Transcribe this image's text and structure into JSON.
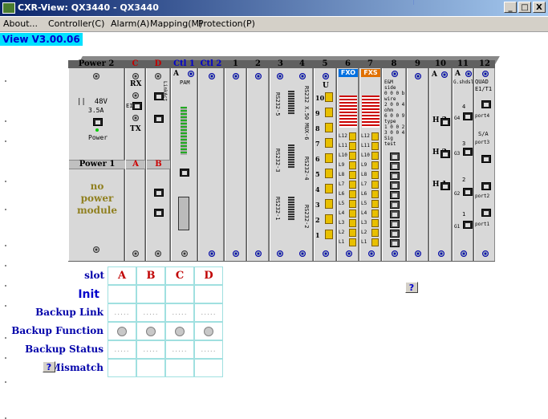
{
  "window": {
    "title": "CXR-View: QX3440 - QX3440",
    "minimize": "_",
    "maximize": "□",
    "close": "X"
  },
  "menu": [
    {
      "label": "About..."
    },
    {
      "label": "Controller(C)"
    },
    {
      "label": "Alarm(A)"
    },
    {
      "label": "Mapping(M)"
    },
    {
      "label": "Protection(P)"
    }
  ],
  "version": "View V3.00.06",
  "chassis": {
    "slot_headers": [
      {
        "label": "Power 2",
        "color": "black"
      },
      {
        "label": "C",
        "color": "red"
      },
      {
        "label": "D",
        "color": "red"
      },
      {
        "label": "Ctl 1",
        "color": "blue"
      },
      {
        "label": "Ctl 2",
        "color": "blue"
      },
      {
        "label": "1",
        "color": "black"
      },
      {
        "label": "2",
        "color": "black"
      },
      {
        "label": "3",
        "color": "black"
      },
      {
        "label": "4",
        "color": "black"
      },
      {
        "label": "5",
        "color": "black"
      },
      {
        "label": "6",
        "color": "black"
      },
      {
        "label": "7",
        "color": "black"
      },
      {
        "label": "8",
        "color": "black"
      },
      {
        "label": "9",
        "color": "black"
      },
      {
        "label": "10",
        "color": "black"
      },
      {
        "label": "11",
        "color": "black"
      },
      {
        "label": "12",
        "color": "black"
      }
    ],
    "power1_label": "Power 1",
    "power1_a": "A",
    "power1_b": "B",
    "power_module_msg": [
      "no",
      "power",
      "module"
    ],
    "power2": {
      "voltage": "48V",
      "current": "3.5A",
      "power": "Power"
    },
    "slot_c": {
      "rx": "RX",
      "tx": "TX",
      "ei": "EI",
      "e1": "E1"
    },
    "slot_d": {
      "link": "LinkAct",
      "txt": "10M/100M Col"
    },
    "ctl1": {
      "a": "A",
      "pam": "PAM"
    },
    "slot34": {
      "rs1": "RS232-5",
      "rs2": "RS232-3",
      "rs3": "RS232-1",
      "rs4": "RS232 X.50 MUX-6",
      "rs5": "RS232-4",
      "rs6": "RS232-2"
    },
    "slot5": {
      "u": "U",
      "nums": [
        "10",
        "9",
        "8",
        "7",
        "6",
        "5",
        "4",
        "3",
        "2",
        "1"
      ]
    },
    "slot6": {
      "head": "FXO",
      "ports": [
        "L12",
        "L11",
        "L10",
        "L9",
        "L8",
        "L7",
        "L6",
        "L5",
        "L4",
        "L3",
        "L2",
        "L1"
      ]
    },
    "slot7": {
      "head": "FXS"
    },
    "slot8": {
      "lines": [
        "E&M",
        "side",
        "0 0 0 b",
        "wire",
        "2 0 0 4",
        "ohm",
        "6 0 0 9",
        "type",
        "1 0 0 2",
        "3 0 0 4",
        "Sig",
        "test"
      ]
    },
    "slot10": {
      "a": "A",
      "h3": "H 3",
      "h2": "H 2",
      "h1": "H 1"
    },
    "slot11": {
      "a": "A",
      "shdsl": "G.shdsl",
      "g4": "G4",
      "g3": "G3",
      "g2": "G2",
      "g1": "G1",
      "n4": "4",
      "n3": "3",
      "n2": "2",
      "n1": "1"
    },
    "slot12": {
      "quad": "QUAD",
      "e1t1": "E1/T1",
      "port4": "port4",
      "sa": "S/A",
      "port3": "port3",
      "port2": "port2",
      "port1": "port1"
    }
  },
  "protection": {
    "header_label": "slot",
    "columns": [
      "A",
      "B",
      "C",
      "D"
    ],
    "rows": [
      {
        "label": "Init",
        "kind": "empty"
      },
      {
        "label": "Backup Link",
        "kind": "dots"
      },
      {
        "label": "Backup Function",
        "kind": "radio"
      },
      {
        "label": "Backup Status",
        "kind": "dots"
      },
      {
        "label": "Mismatch",
        "kind": "empty"
      }
    ],
    "dots_text": ".....",
    "help_button": "?"
  },
  "side_help_button": "?"
}
